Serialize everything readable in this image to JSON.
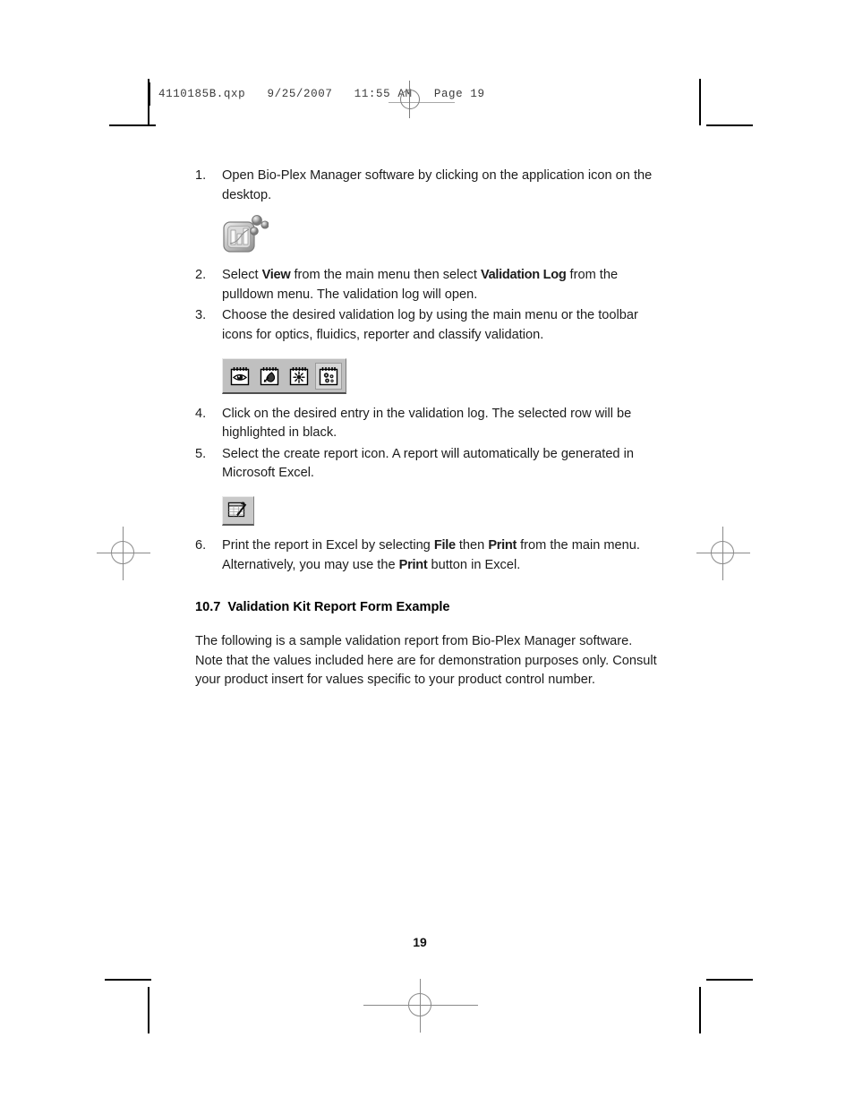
{
  "print_header": {
    "filename_line": "4110185B.qxp   9/25/2007   11:55 AM   Page 19"
  },
  "steps": [
    {
      "number": "1.",
      "text_before": "Open Bio-Plex Manager software by clicking on the application icon on the desktop.",
      "bold1": "",
      "text_mid": "",
      "bold2": "",
      "text_after": ""
    },
    {
      "number": "2.",
      "text_before": "Select ",
      "bold1": "View",
      "text_mid": " from the main menu then select ",
      "bold2": "Validation Log",
      "text_after": " from the pulldown menu. The validation log will open."
    },
    {
      "number": "3.",
      "text_before": "Choose the desired validation log by using the main menu or the toolbar icons for optics, fluidics, reporter and classify validation.",
      "bold1": "",
      "text_mid": "",
      "bold2": "",
      "text_after": ""
    },
    {
      "number": "4.",
      "text_before": "Click on the desired entry in the validation log. The selected row will be highlighted in black.",
      "bold1": "",
      "text_mid": "",
      "bold2": "",
      "text_after": ""
    },
    {
      "number": "5.",
      "text_before": "Select the create report icon. A report will automatically be generated in Microsoft Excel.",
      "bold1": "",
      "text_mid": "",
      "bold2": "",
      "text_after": ""
    },
    {
      "number": "6.",
      "text_before": "Print the report in Excel by selecting ",
      "bold1": "File",
      "text_mid": " then ",
      "bold2": "Print",
      "text_after": " from the main menu. Alternatively, you may use the ",
      "bold3": "Print",
      "text_end": " button in Excel."
    }
  ],
  "figures": {
    "app_icon": {
      "name": "bio-plex-manager-application-icon",
      "description": "Rounded square chart icon with three beads"
    },
    "toolbar": {
      "name": "validation-log-toolbar",
      "buttons": [
        {
          "label": "Optics validation",
          "icon": "eye-icon",
          "pressed": false
        },
        {
          "label": "Fluidics validation",
          "icon": "droplet-icon",
          "pressed": false
        },
        {
          "label": "Reporter validation",
          "icon": "starburst-icon",
          "pressed": false
        },
        {
          "label": "Classify validation",
          "icon": "beads-icon",
          "pressed": true
        }
      ]
    },
    "report_icon": {
      "name": "create-report-icon",
      "label": "Create report",
      "icon": "spreadsheet-wand-icon"
    }
  },
  "section": {
    "number": "10.7",
    "title": "Validation Kit Report Form Example",
    "paragraph": "The following is a sample validation report from Bio-Plex Manager software. Note that the values included here are for demonstration purposes only. Consult your product insert for values specific to your product control number."
  },
  "footer": {
    "page_number": "19"
  },
  "colors": {
    "text": "#1c1c1c",
    "toolbar_face": "#c0c0c0",
    "mark_gray": "#8a8a8a"
  }
}
